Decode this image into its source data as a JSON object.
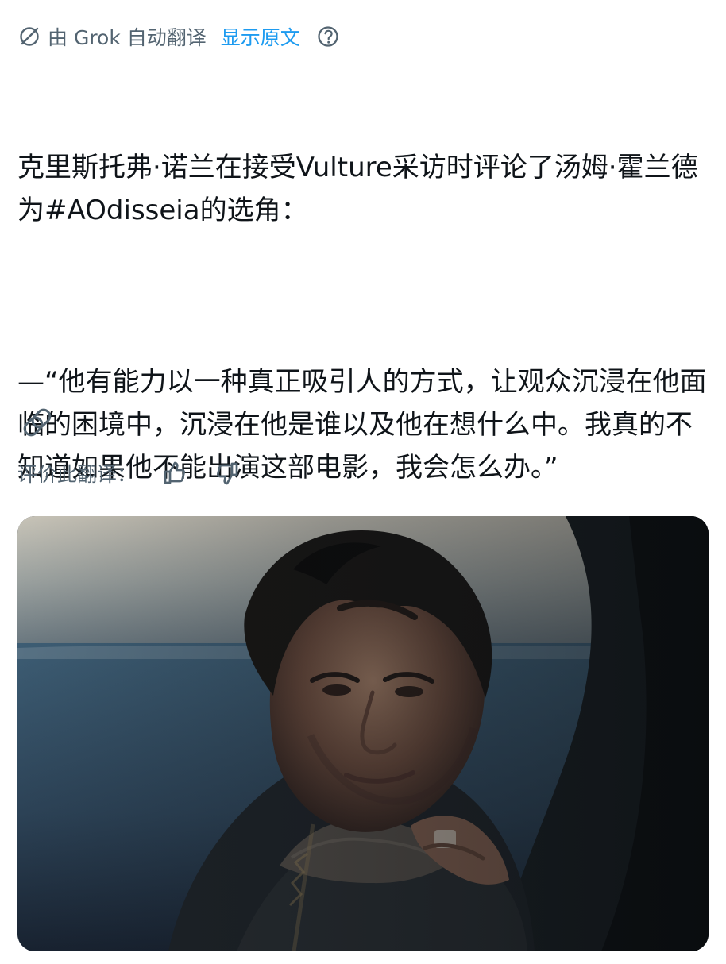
{
  "translation": {
    "provider_text": "由 Grok 自动翻译",
    "show_original": "显示原文",
    "icons": {
      "provider": "grok-icon",
      "help": "question-circle-icon"
    }
  },
  "post": {
    "paragraphs": [
      "克里斯托弗·诺兰在接受Vulture采访时评论了汤姆·霍兰德为#AOdisseia的选角：",
      "—“他有能力以一种真正吸引人的方式，让观众沉浸在他面临的困境中，沉浸在他是谁以及他在想什么中。我真的不知道如果他不能出演这部电影，我会怎么办。”"
    ]
  },
  "actions": {
    "link_icon": "link-icon"
  },
  "rating": {
    "label": "评价此翻译：",
    "up_icon": "thumbs-up-icon",
    "down_icon": "thumbs-down-icon"
  },
  "media": {
    "kind": "photo",
    "subject": "man-on-boat"
  },
  "colors": {
    "text": "#0f1419",
    "muted": "#536471",
    "link": "#1d9bf0",
    "background": "#ffffff"
  }
}
